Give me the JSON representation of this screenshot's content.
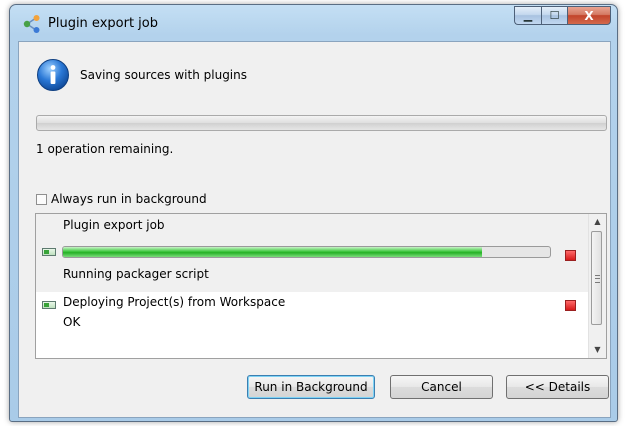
{
  "window": {
    "title": "Plugin export job",
    "minimize_glyph": "▁",
    "maximize_glyph": "☐",
    "close_glyph": "X"
  },
  "dialog": {
    "message": "Saving sources with plugins",
    "remaining": "1 operation remaining.",
    "always_background_label": "Always run in background",
    "always_background_checked": false
  },
  "jobs": [
    {
      "title": "Plugin export job",
      "status": "Running packager script",
      "progress": 0.86
    },
    {
      "title": "Deploying Project(s) from Workspace",
      "status": "OK"
    }
  ],
  "buttons": {
    "run_in_background": "Run in Background",
    "cancel": "Cancel",
    "details": "<< Details"
  },
  "icons": {
    "app": "plugin-share-icon",
    "info": "info-icon",
    "job": "job-progress-icon",
    "stop": "stop-icon"
  },
  "colors": {
    "progress_green": "#25b025",
    "stop_red": "#d71a1a",
    "default_button_border": "#3c7fb1"
  }
}
